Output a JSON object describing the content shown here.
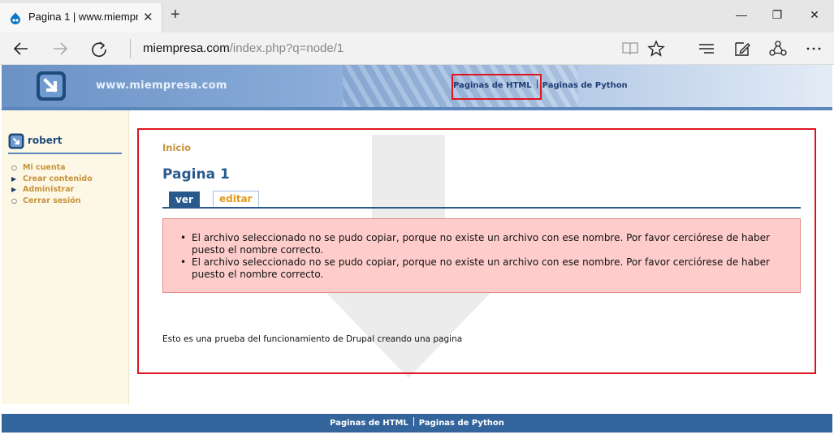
{
  "browser": {
    "tab": {
      "title": "Pagina 1 | www.miempresa.com",
      "close": "✕"
    },
    "new_tab": "+",
    "window": {
      "minimize": "—",
      "maximize": "❐",
      "close": "✕"
    },
    "url": {
      "host": "miempresa.com",
      "path": "/index.php?q=node/1"
    },
    "icons": [
      "back-arrow",
      "forward-arrow",
      "refresh",
      "reading-view",
      "favorite-star",
      "hub",
      "web-note",
      "share",
      "more"
    ]
  },
  "site": {
    "name": "www.miempresa.com",
    "primary_links": [
      "Paginas de HTML",
      "Paginas de Python"
    ]
  },
  "sidebar": {
    "user": "robert",
    "menu": [
      "Mi cuenta",
      "Crear contenido",
      "Administrar",
      "Cerrar sesión"
    ]
  },
  "content": {
    "breadcrumb": "Inicio",
    "title": "Pagina 1",
    "tabs": {
      "view": "ver",
      "edit": "editar"
    },
    "errors": [
      "El archivo seleccionado no se pudo copiar, porque no existe un archivo con ese nombre. Por favor cerciórese de haber puesto el nombre correcto.",
      "El archivo seleccionado no se pudo copiar, porque no existe un archivo con ese nombre. Por favor cerciórese de haber puesto el nombre correcto."
    ],
    "body": "Esto es una prueba del funcionamiento de Drupal creando una pagina"
  },
  "footer": {
    "links": [
      "Paginas de HTML",
      "Paginas de Python"
    ]
  },
  "colors": {
    "header_gradient_start": "#6b92c6",
    "brand_blue": "#2a5a8c",
    "link_gold": "#c6923a",
    "edit_tab_orange": "#e39a1a",
    "error_bg": "#ffcccc",
    "highlight_red": "#e0141e",
    "footer_bg": "#34649c",
    "sidebar_bg": "#fdf8e6"
  }
}
